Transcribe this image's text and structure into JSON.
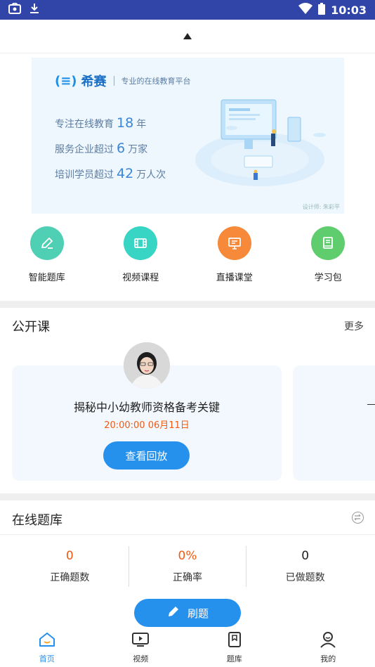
{
  "status_bar": {
    "time": "10:03"
  },
  "banner": {
    "brand": "希赛",
    "slogan": "专业的在线教育平台",
    "lines": [
      {
        "prefix": "专注在线教育",
        "num": "18",
        "suffix": "年"
      },
      {
        "prefix": "服务企业超过",
        "num": "6",
        "suffix": "万家"
      },
      {
        "prefix": "培训学员超过",
        "num": "42",
        "suffix": "万人次"
      }
    ],
    "credit": "设计师: 朱彩平"
  },
  "quick_menu": [
    {
      "label": "智能题库",
      "icon": "pencil-icon",
      "color": "#4fcfb4"
    },
    {
      "label": "视频课程",
      "icon": "film-icon",
      "color": "#38d4c4"
    },
    {
      "label": "直播课堂",
      "icon": "presentation-icon",
      "color": "#f6893a"
    },
    {
      "label": "学习包",
      "icon": "book-icon",
      "color": "#5fcc6d"
    }
  ],
  "open_course": {
    "title": "公开课",
    "more": "更多",
    "card": {
      "title": "揭秘中小幼教师资格备考关键",
      "time": "20:00:00  06月11日",
      "button": "查看回放"
    }
  },
  "question_bank": {
    "title": "在线题库",
    "stats": [
      {
        "value": "0",
        "label": "正确题数"
      },
      {
        "value": "0%",
        "label": "正确率"
      },
      {
        "value": "0",
        "label": "已做题数"
      }
    ],
    "button": "刷题"
  },
  "tabs": [
    {
      "label": "首页",
      "icon": "home-icon",
      "active": true
    },
    {
      "label": "视频",
      "icon": "tv-icon",
      "active": false
    },
    {
      "label": "题库",
      "icon": "bookmark-icon",
      "active": false
    },
    {
      "label": "我的",
      "icon": "user-icon",
      "active": false
    }
  ],
  "colors": {
    "accent": "#2690ed",
    "status_bar": "#3144a8",
    "highlight": "#f05a12"
  }
}
